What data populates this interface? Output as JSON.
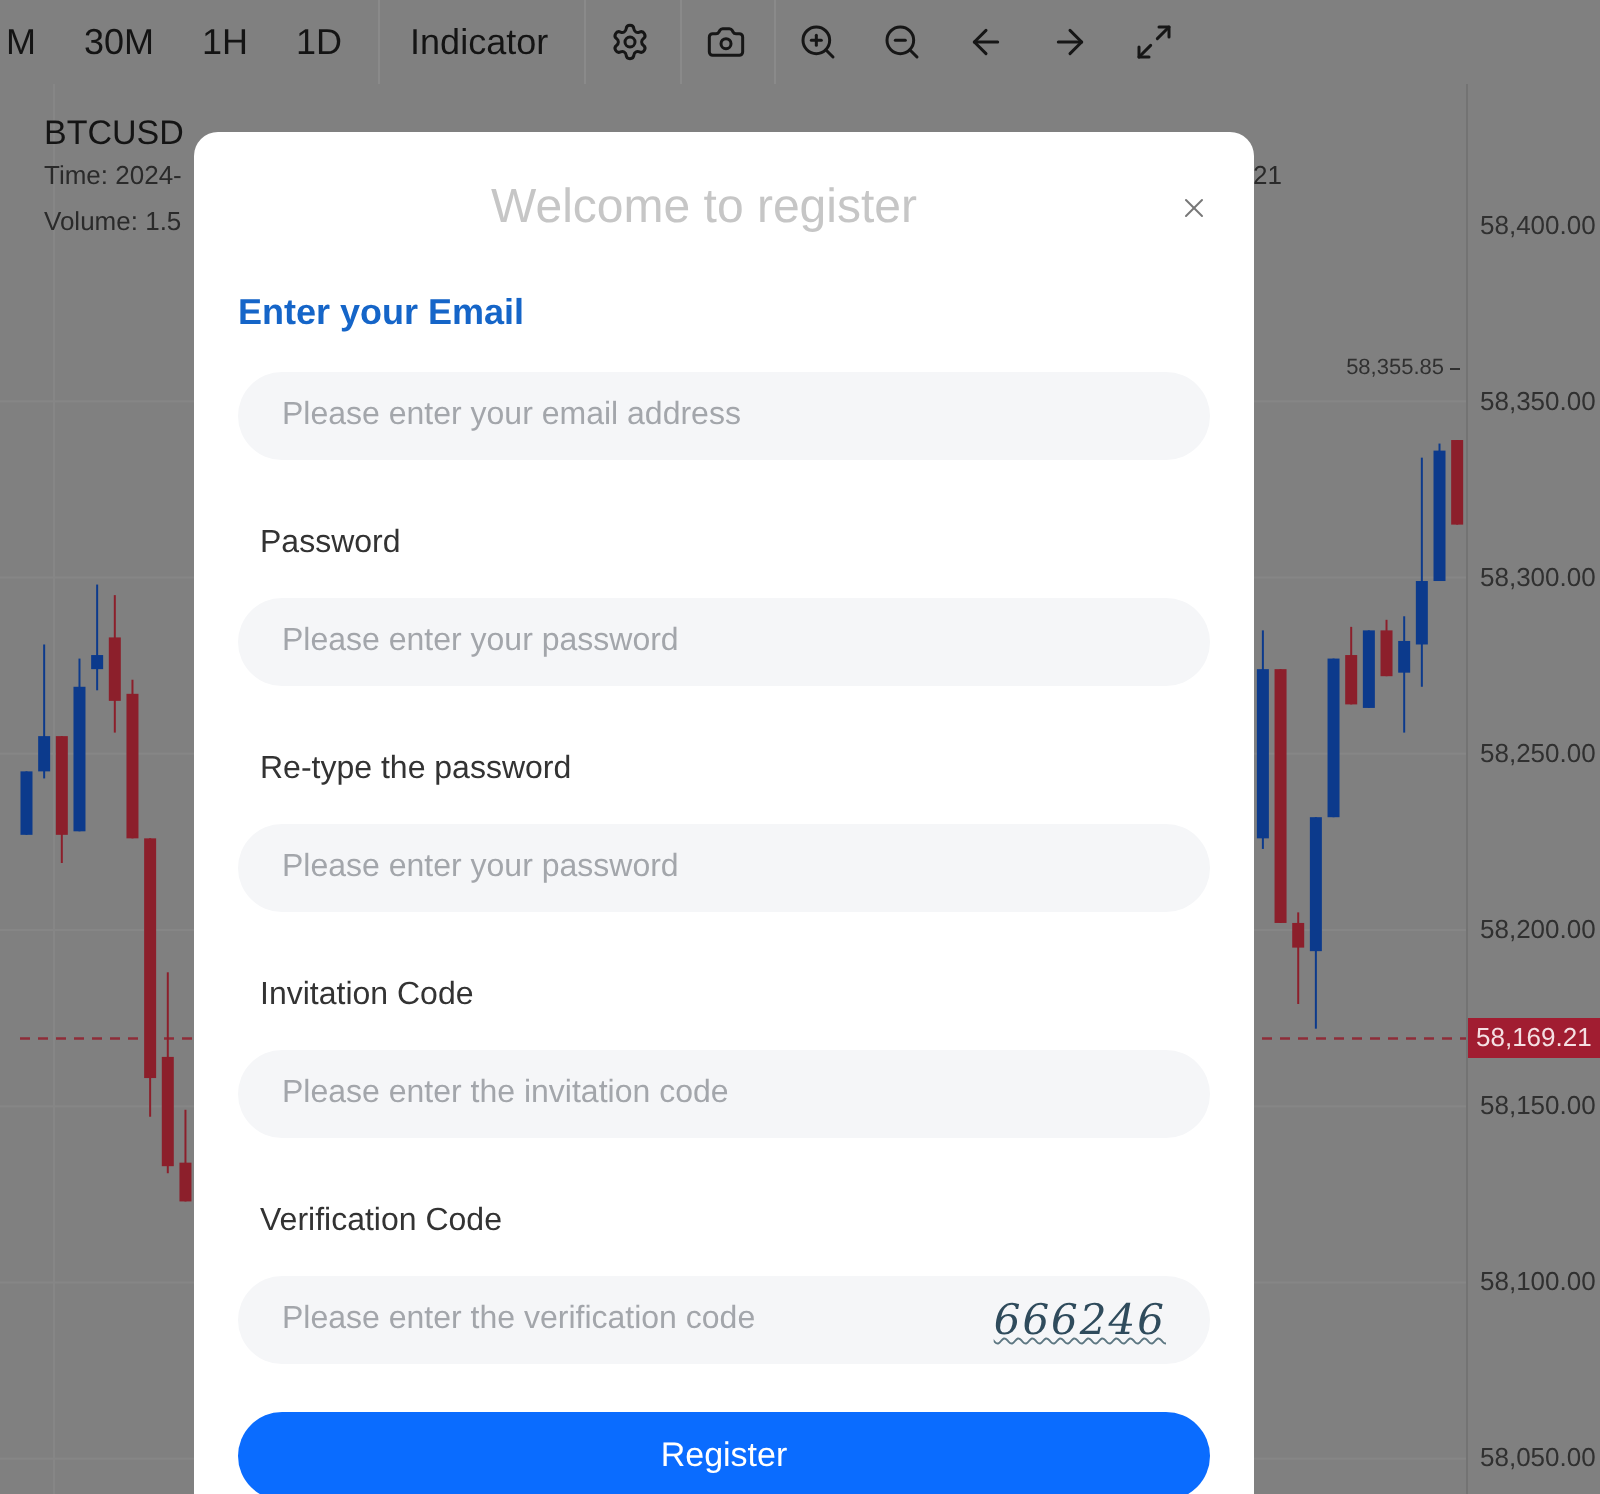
{
  "toolbar": {
    "intervals": [
      "M",
      "30M",
      "1H",
      "1D"
    ],
    "indicator": "Indicator"
  },
  "chart": {
    "symbol": "BTCUSD",
    "time": "Time: 2024-",
    "time_tail": "21",
    "volume": "Volume: 1.5",
    "high_label": "58,355.85",
    "current_price": "58,169.21",
    "chart_data": {
      "type": "candlestick",
      "grid": true,
      "categories": [
        null,
        null,
        null,
        null,
        null,
        null,
        null,
        null,
        null,
        null,
        null,
        null,
        null,
        null,
        null,
        null,
        null,
        null,
        null,
        null,
        null,
        null,
        null,
        null,
        null,
        null,
        null,
        null,
        null,
        null,
        null,
        null,
        null,
        null,
        null,
        null,
        null,
        null,
        null,
        null,
        null,
        null,
        null,
        null,
        null,
        null,
        null,
        null,
        null,
        null,
        null,
        null,
        null,
        null,
        null,
        null,
        null,
        null,
        null,
        null,
        null,
        null,
        null,
        null,
        null,
        null,
        null,
        null,
        null,
        null,
        null,
        null,
        null,
        null,
        null,
        null,
        null,
        null,
        null,
        null,
        null,
        null,
        null
      ],
      "ohlc": [
        null,
        [
          58227,
          58245,
          58227,
          58245
        ],
        [
          58245,
          58281,
          58243,
          58255
        ],
        [
          58255,
          58255,
          58219,
          58227
        ],
        [
          58228,
          58277,
          58228,
          58269
        ],
        [
          58274,
          58298,
          58268,
          58278
        ],
        [
          58283,
          58295,
          58256,
          58265
        ],
        [
          58267,
          58271,
          58226,
          58226
        ],
        [
          58226,
          58226,
          58147,
          58158
        ],
        [
          58164,
          58188,
          58131,
          58133
        ],
        [
          58134,
          58149,
          58123,
          58123
        ],
        null,
        null,
        null,
        null,
        null,
        null,
        null,
        null,
        null,
        null,
        null,
        null,
        null,
        null,
        null,
        null,
        null,
        null,
        null,
        null,
        null,
        null,
        null,
        null,
        null,
        null,
        null,
        null,
        null,
        null,
        null,
        null,
        null,
        null,
        null,
        null,
        null,
        null,
        null,
        null,
        null,
        null,
        null,
        null,
        null,
        null,
        null,
        null,
        null,
        null,
        null,
        null,
        null,
        null,
        null,
        null,
        null,
        null,
        null,
        null,
        [
          58226,
          58285,
          58223,
          58274
        ],
        [
          58274,
          58274,
          58202,
          58202
        ],
        [
          58202,
          58205,
          58179,
          58195
        ],
        [
          58194,
          58232,
          58172,
          58232
        ],
        [
          58232,
          58277,
          58232,
          58277
        ],
        [
          58278,
          58286,
          58264,
          58264
        ],
        [
          58263,
          58285,
          58263,
          58285
        ],
        [
          58285,
          58288,
          58272,
          58272
        ],
        [
          58273,
          58289,
          58256,
          58282
        ],
        [
          58281,
          58334,
          58269,
          58299
        ],
        [
          58299,
          58338,
          58299,
          58336
        ],
        [
          58339,
          58339,
          58315,
          58315
        ]
      ],
      "ylim": [
        58040,
        58440
      ],
      "yticks": [
        {
          "value": 58400,
          "label": "58,400.00"
        },
        {
          "value": 58350,
          "label": "58,350.00"
        },
        {
          "value": 58300,
          "label": "58,300.00"
        },
        {
          "value": 58250,
          "label": "58,250.00"
        },
        {
          "value": 58200,
          "label": "58,200.00"
        },
        {
          "value": 58150,
          "label": "58,150.00"
        },
        {
          "value": 58100,
          "label": "58,100.00"
        },
        {
          "value": 58050,
          "label": "58,050.00"
        }
      ],
      "ref_lines": [
        {
          "axis": "y",
          "value": 58169.21
        }
      ]
    }
  },
  "dialog": {
    "title": "Welcome to register",
    "fields": [
      {
        "kind": "email",
        "label": "Enter your Email",
        "placeholder": "Please enter your email address"
      },
      {
        "kind": "password",
        "label": "Password",
        "placeholder": "Please enter your password"
      },
      {
        "kind": "password",
        "label": "Re-type the password",
        "placeholder": "Please enter your password"
      },
      {
        "kind": "text",
        "label": "Invitation Code",
        "placeholder": "Please enter the invitation code"
      },
      {
        "kind": "captcha",
        "label": "Verification Code",
        "placeholder": "Please enter the verification code",
        "captcha": "666246"
      }
    ],
    "submit": "Register"
  }
}
